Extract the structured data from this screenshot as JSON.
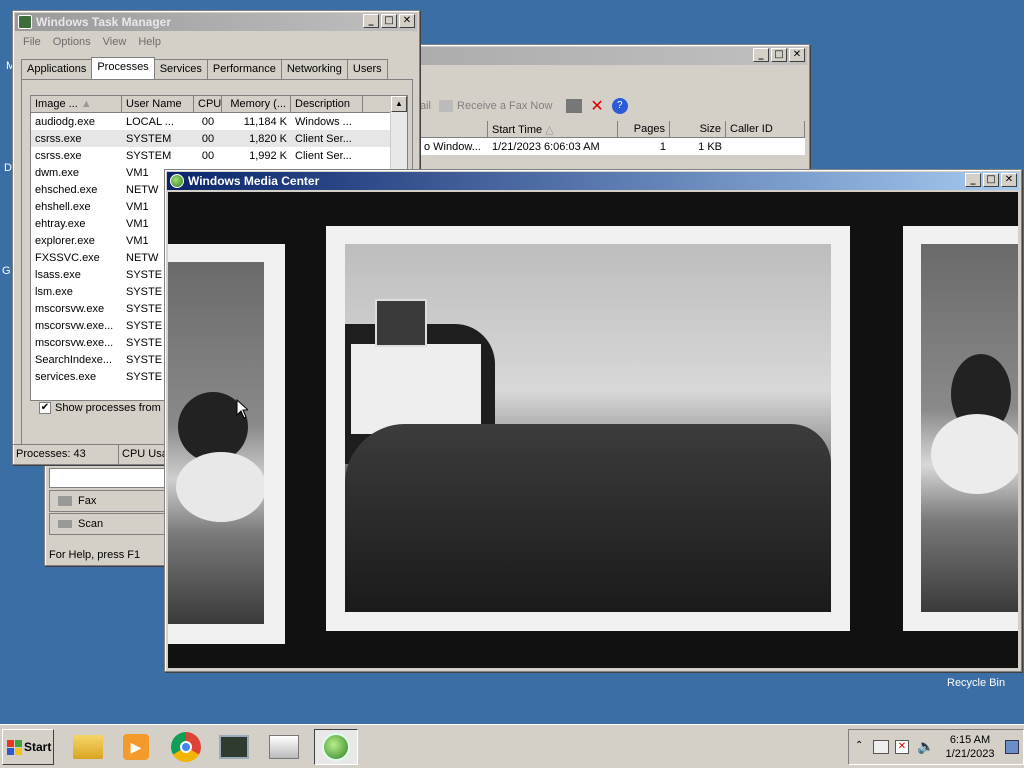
{
  "desktop": {
    "recycle_bin": "Recycle Bin",
    "edge_labels": [
      "M",
      "D",
      "G"
    ]
  },
  "taskmgr": {
    "title": "Windows Task Manager",
    "menu": [
      "File",
      "Options",
      "View",
      "Help"
    ],
    "tabs": [
      "Applications",
      "Processes",
      "Services",
      "Performance",
      "Networking",
      "Users"
    ],
    "selected_tab": "Processes",
    "columns": [
      "Image ...",
      "User Name",
      "CPU",
      "Memory (...",
      "Description"
    ],
    "rows": [
      [
        "audiodg.exe",
        "LOCAL ...",
        "00",
        "11,184 K",
        "Windows ..."
      ],
      [
        "csrss.exe",
        "SYSTEM",
        "00",
        "1,820 K",
        "Client Ser..."
      ],
      [
        "csrss.exe",
        "SYSTEM",
        "00",
        "1,992 K",
        "Client Ser..."
      ],
      [
        "dwm.exe",
        "VM1",
        "",
        "",
        ""
      ],
      [
        "ehsched.exe",
        "NETW",
        "",
        "",
        ""
      ],
      [
        "ehshell.exe",
        "VM1",
        "",
        "",
        ""
      ],
      [
        "ehtray.exe",
        "VM1",
        "",
        "",
        ""
      ],
      [
        "explorer.exe",
        "VM1",
        "",
        "",
        ""
      ],
      [
        "FXSSVC.exe",
        "NETW",
        "",
        "",
        ""
      ],
      [
        "lsass.exe",
        "SYSTE",
        "",
        "",
        ""
      ],
      [
        "lsm.exe",
        "SYSTE",
        "",
        "",
        ""
      ],
      [
        "mscorsvw.exe",
        "SYSTE",
        "",
        "",
        ""
      ],
      [
        "mscorsvw.exe...",
        "SYSTE",
        "",
        "",
        ""
      ],
      [
        "mscorsvw.exe...",
        "SYSTE",
        "",
        "",
        ""
      ],
      [
        "SearchIndexe...",
        "SYSTE",
        "",
        "",
        ""
      ],
      [
        "services.exe",
        "SYSTE",
        "",
        "",
        ""
      ]
    ],
    "show_all_label": "Show processes from a",
    "show_all_checked": true,
    "status_processes": "Processes: 43",
    "status_cpu": "CPU Usa"
  },
  "fax": {
    "toolbar_mail": "ail",
    "toolbar_receive": "Receive a Fax Now",
    "columns": [
      "",
      "Start Time",
      "Pages",
      "Size",
      "Caller ID"
    ],
    "row": [
      "o Window...",
      "1/21/2023 6:06:03 AM",
      "1",
      "1 KB",
      ""
    ],
    "nav": [
      "Fax",
      "Scan"
    ],
    "status": "For Help, press F1"
  },
  "wmc": {
    "title": "Windows Media Center"
  },
  "taskbar": {
    "start_label": "Start",
    "time": "6:15 AM",
    "date": "1/21/2023"
  }
}
